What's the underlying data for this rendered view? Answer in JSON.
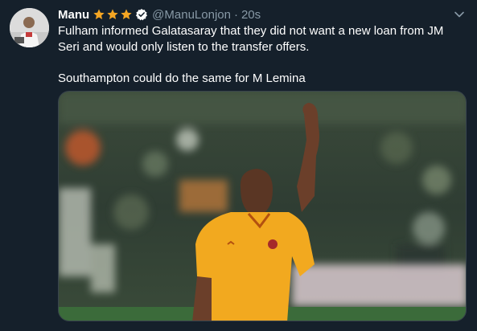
{
  "tweet": {
    "display_name": "Manu",
    "handle": "@ManuLonjon",
    "separator": "·",
    "timestamp": "20s",
    "badges": [
      "star-icon",
      "star-icon",
      "star-icon",
      "verified-icon"
    ],
    "lines": [
      "Fulham informed Galatasaray that they did not want a new loan from JM Seri and would only listen to the transfer offers.",
      "Southampton could do the same for M Lemina"
    ]
  },
  "colors": {
    "background": "#15202b",
    "text_primary": "#ffffff",
    "text_secondary": "#8899a6",
    "star": "#f5a623",
    "jersey": "#f2a91f"
  },
  "icons": {
    "menu": "chevron-down-icon"
  }
}
